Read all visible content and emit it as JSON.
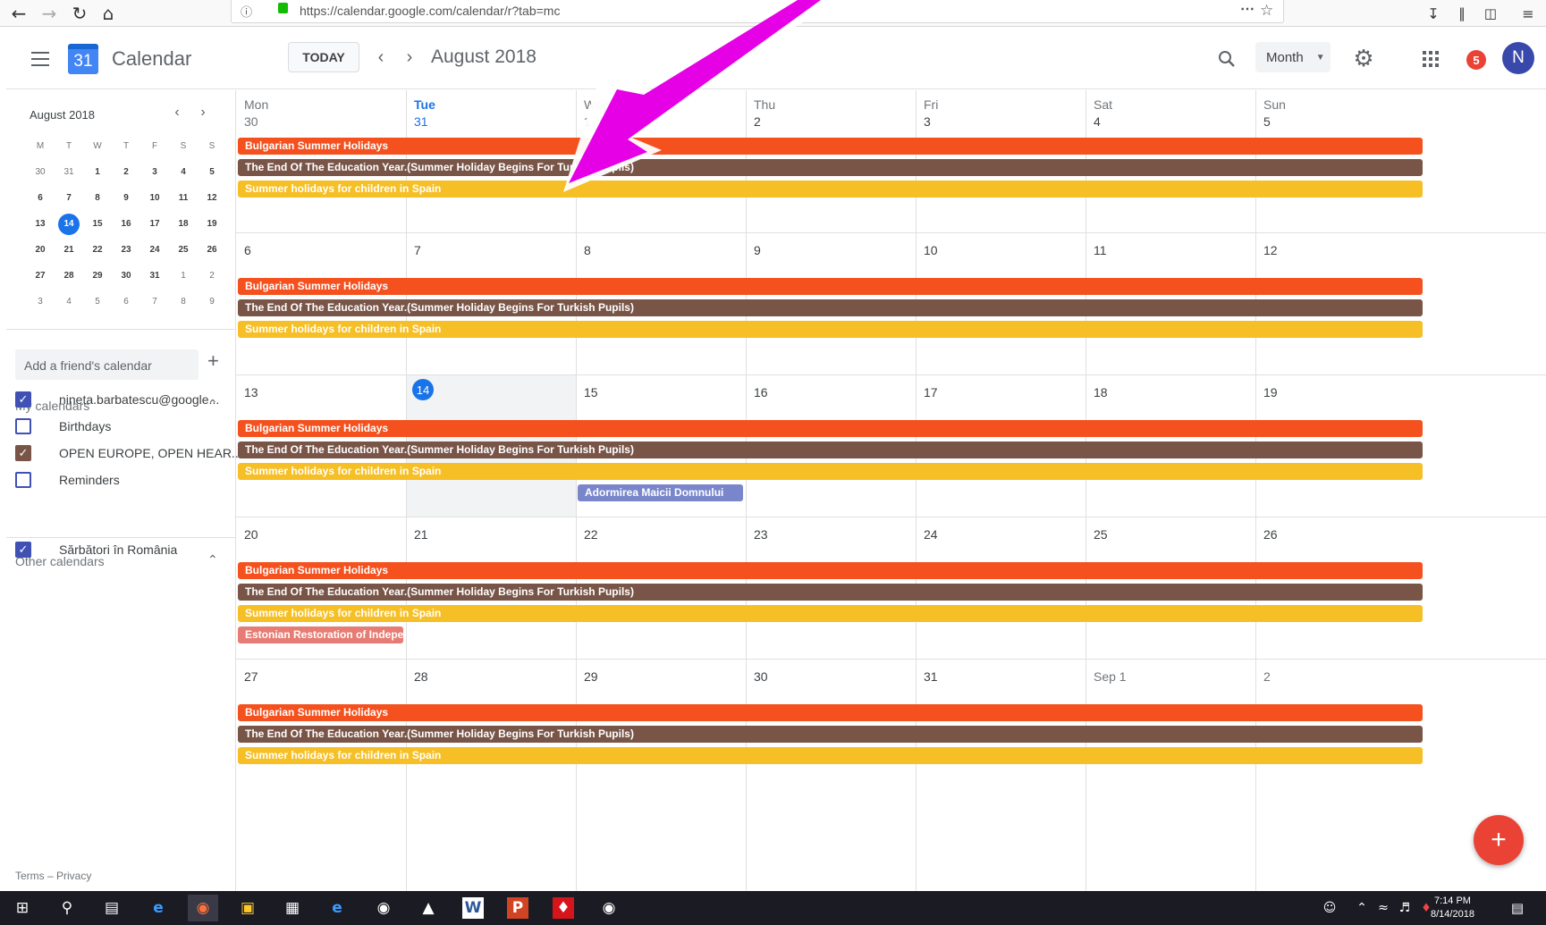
{
  "browser": {
    "url": "https://calendar.google.com/calendar/r?tab=mc"
  },
  "header": {
    "app_name": "Calendar",
    "logo_day": "31",
    "today_label": "TODAY",
    "current_period": "August 2018",
    "view": "Month",
    "notification_count": "5",
    "avatar_initial": "N"
  },
  "mini": {
    "title": "August 2018",
    "weekdays": [
      "M",
      "T",
      "W",
      "T",
      "F",
      "S",
      "S"
    ],
    "weeks": [
      [
        "30",
        "31",
        "1",
        "2",
        "3",
        "4",
        "5"
      ],
      [
        "6",
        "7",
        "8",
        "9",
        "10",
        "11",
        "12"
      ],
      [
        "13",
        "14",
        "15",
        "16",
        "17",
        "18",
        "19"
      ],
      [
        "20",
        "21",
        "22",
        "23",
        "24",
        "25",
        "26"
      ],
      [
        "27",
        "28",
        "29",
        "30",
        "31",
        "1",
        "2"
      ],
      [
        "3",
        "4",
        "5",
        "6",
        "7",
        "8",
        "9"
      ]
    ]
  },
  "sidebar": {
    "add_friend": "Add a friend's calendar",
    "my_calendars": "My calendars",
    "other_calendars": "Other calendars",
    "my": [
      {
        "label": "nineta.barbatescu@google...",
        "checked": true
      },
      {
        "label": "Birthdays",
        "checked": false
      },
      {
        "label": "OPEN EUROPE, OPEN HEAR...",
        "checked": true
      },
      {
        "label": "Reminders",
        "checked": false
      }
    ],
    "other": [
      {
        "label": "Sărbători în România",
        "checked": true
      }
    ],
    "footer": "Terms – Privacy"
  },
  "month": {
    "headers": [
      "Mon",
      "Tue",
      "Wed",
      "Thu",
      "Fri",
      "Sat",
      "Sun"
    ],
    "weeks": [
      [
        "30",
        "31",
        "1",
        "2",
        "3",
        "4",
        "5"
      ],
      [
        "6",
        "7",
        "8",
        "9",
        "10",
        "11",
        "12"
      ],
      [
        "13",
        "14",
        "15",
        "16",
        "17",
        "18",
        "19"
      ],
      [
        "20",
        "21",
        "22",
        "23",
        "24",
        "25",
        "26"
      ],
      [
        "27",
        "28",
        "29",
        "30",
        "31",
        "Sep 1",
        "2"
      ]
    ]
  },
  "events": {
    "bulgarian": "Bulgarian Summer Holidays",
    "turkish": "The End Of The Education Year.(Summer Holiday Begins For Turkish Pupils)",
    "spain": "Summer holidays for children in Spain",
    "adormirea": "Adormirea Maicii Domnului",
    "estonian": "Estonian Restoration of Independence"
  },
  "taskbar": {
    "time": "7:14 PM",
    "date": "8/14/2018"
  },
  "colors": {
    "orange": "#f4511e",
    "brown": "#795548",
    "yellow": "#f6bf26",
    "lavender": "#7986cb",
    "flamingo": "#e67c73",
    "annotation_arrow": "#e600e6"
  }
}
